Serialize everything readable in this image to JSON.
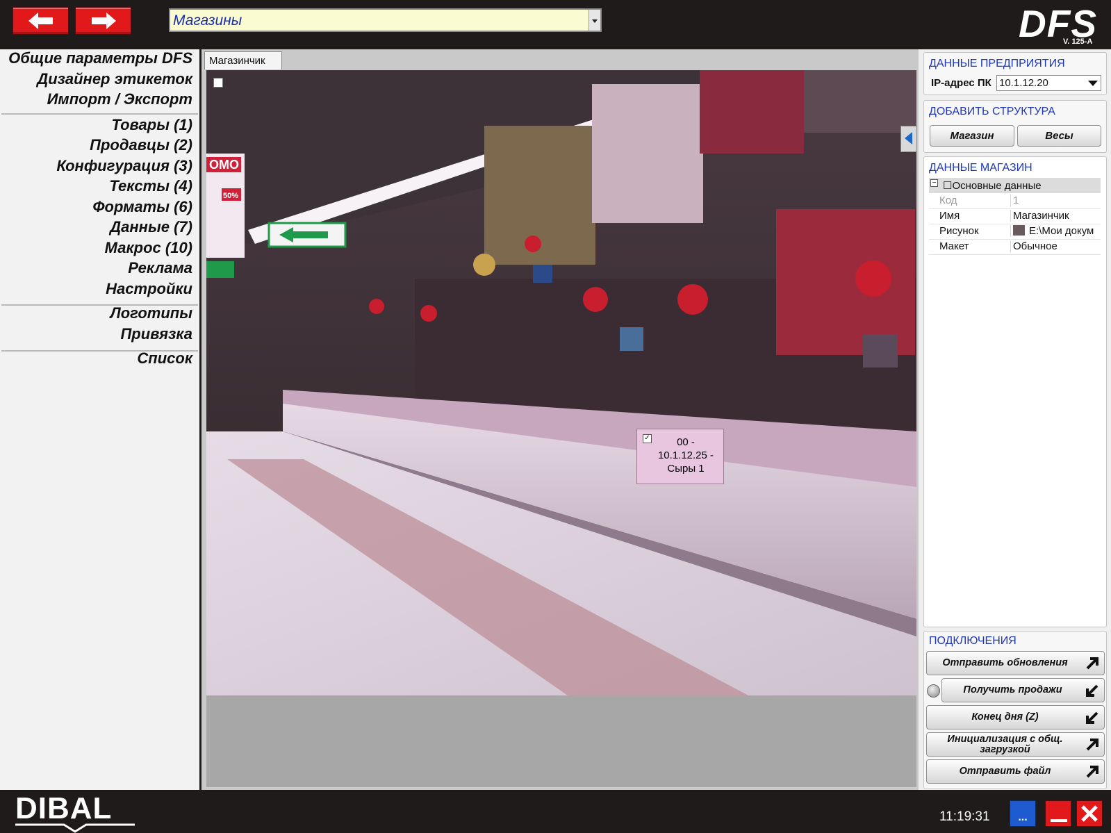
{
  "header": {
    "back_icon": "arrow-left-icon",
    "forward_icon": "arrow-right-icon",
    "combo_value": "Магазины",
    "logo": "DFS",
    "version": "V. 125-A"
  },
  "left_menu": {
    "group1": [
      "Общие параметры DFS",
      "Дизайнер этикеток",
      "Импорт / Экспорт"
    ],
    "group2": [
      "Товары (1)",
      "Продавцы (2)",
      "Конфигурация (3)",
      "Тексты (4)",
      "Форматы (6)",
      "Данные (7)",
      "Макрос (10)",
      "Реклама",
      "Настройки"
    ],
    "group3": [
      "Логотипы",
      "Привязка"
    ],
    "group4": [
      "Список"
    ]
  },
  "center": {
    "tab_label": "Магазинчик",
    "scale_card": {
      "checked": true,
      "lines": [
        "00 -",
        "10.1.12.25 -",
        "Сыры 1"
      ]
    },
    "scene_signs": {
      "promo": "OMO",
      "discount": "50%"
    }
  },
  "right_panel": {
    "enterprise": {
      "title": "ДАННЫЕ ПРЕДПРИЯТИЯ",
      "ip_label": "IP-адрес ПК",
      "ip_value": "10.1.12.20"
    },
    "add_structure": {
      "title": "ДОБАВИТЬ СТРУКТУРА",
      "btn_store": "Магазин",
      "btn_scales": "Весы"
    },
    "store_data": {
      "title": "ДАННЫЕ МАГАЗИН",
      "group": "Основные данные",
      "rows": [
        {
          "key": "Код",
          "value": "1"
        },
        {
          "key": "Имя",
          "value": "Магазинчик"
        },
        {
          "key": "Рисунок",
          "value": "E:\\Мои докум"
        },
        {
          "key": "Макет",
          "value": "Обычное"
        }
      ]
    },
    "connections": {
      "title": "ПОДКЛЮЧЕНИЯ",
      "buttons": [
        "Отправить обновления",
        "Получить продажи",
        "Конец дня (Z)",
        "Инициализация с общ. загрузкой",
        "Отправить файл"
      ]
    }
  },
  "footer": {
    "brand": "DIBAL",
    "clock": "11:19:31",
    "more_label": "...",
    "colors": {
      "accent_red": "#e2191b",
      "title_blue": "#1d37b8",
      "menu_btn_blue": "#1f5bd0"
    }
  }
}
